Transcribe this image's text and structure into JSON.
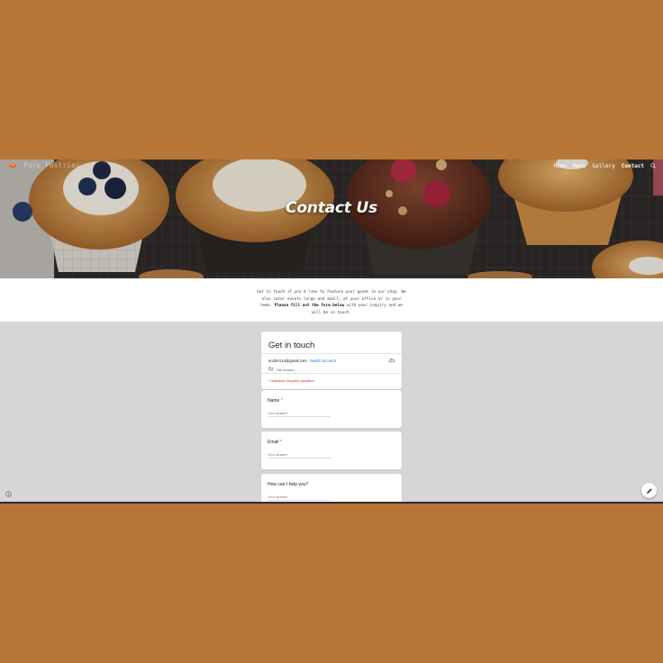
{
  "site": {
    "brand": "Pure Pastries",
    "nav": [
      "Home",
      "Menu",
      "Gallery",
      "Contact"
    ],
    "active_nav": "Contact"
  },
  "hero": {
    "title": "Contact Us"
  },
  "intro": {
    "text_before": "Get in touch if you'd like to feature your goods in our shop. We also cater events large and small, at your office or in your home.",
    "bold": "Please fill out the form below",
    "text_after": " with your inquiry and we will be in touch."
  },
  "form": {
    "title": "Get in touch",
    "account_email": "ecidnrn14@gmail.com",
    "switch_account": "Switch account",
    "not_shared": "Not shared",
    "required_note": "* Indicates required question",
    "answer_placeholder": "Your answer",
    "questions": [
      {
        "label": "Name",
        "required": "*"
      },
      {
        "label": "Email",
        "required": "*"
      },
      {
        "label": "How can I help you?",
        "required": ""
      }
    ]
  },
  "colors": {
    "frame": "#b87538",
    "accent": "#1a73e8",
    "required": "#d93025",
    "form_bg": "#d6d6d6"
  },
  "icons": [
    "logo-icon",
    "search-icon",
    "cloud-icon",
    "not-shared-icon",
    "info-icon",
    "pencil-icon"
  ]
}
